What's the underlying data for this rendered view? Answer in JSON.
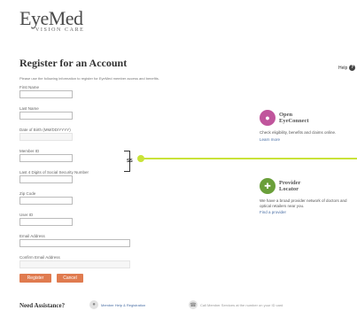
{
  "brand": {
    "name": "EyeMed",
    "tagline": "VISION CARE"
  },
  "page": {
    "title": "Register for an Account",
    "intro": "Please use the following information to register for EyeMed member access and benefits.",
    "help_label": "Help"
  },
  "form": {
    "fields": [
      {
        "label": "First Name"
      },
      {
        "label": "Last Name"
      },
      {
        "label": "Date of Birth (MM/DD/YYYY)"
      },
      {
        "label": "Member ID"
      },
      {
        "label": "Last 4 Digits of Social Security Number"
      },
      {
        "label": "Zip Code"
      },
      {
        "label": "User ID"
      },
      {
        "label": "Email Address"
      },
      {
        "label": "Confirm Email Address"
      }
    ],
    "ssn_connector_label": "SS",
    "register_label": "Register",
    "cancel_label": "Cancel"
  },
  "promos": [
    {
      "title_line1": "Open",
      "title_line2": "EyeConnect",
      "body": "Check eligibility, benefits and claims online.",
      "link": "Learn more",
      "icon": "eye-icon",
      "color": "#c0559c"
    },
    {
      "title_line1": "Provider",
      "title_line2": "Locator",
      "body": "We have a broad provider network of doctors and optical retailers near you.",
      "link": "Find a provider",
      "icon": "doctor-icon",
      "color": "#6a9f3a"
    }
  ],
  "help": {
    "title": "Need Assistance?",
    "item1": "Member Help & Registration",
    "item2": "Call Member Services at the number on your ID card"
  },
  "colors": {
    "accent": "#e07b4f",
    "highlight": "#c9e33a",
    "link": "#4a6fa5"
  }
}
